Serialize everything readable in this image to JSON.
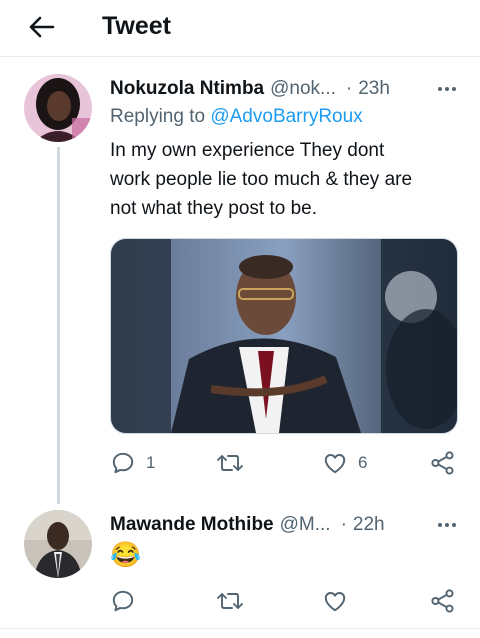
{
  "header": {
    "title": "Tweet"
  },
  "tweets": [
    {
      "name": "Nokuzola Ntimba",
      "handle": "@nok...",
      "time": "23h",
      "replying_prefix": "Replying to",
      "replying_to": "@AdvoBarryRoux",
      "text_lines": [
        "In my own experience They dont",
        "work people lie too much & they are",
        "not what they post to be."
      ],
      "replies": "1",
      "retweets": "",
      "likes": "6"
    },
    {
      "name": "Mawande Mothibe",
      "handle": "@M...",
      "time": "22h",
      "emoji": "😂",
      "replies": "",
      "retweets": "",
      "likes": ""
    }
  ],
  "colors": {
    "accent": "#1d9bf0",
    "secondary_text": "#536471",
    "divider": "#e6ecf0"
  },
  "icons": [
    "back-arrow-icon",
    "more-icon",
    "reply-icon",
    "retweet-icon",
    "like-icon",
    "share-icon"
  ]
}
